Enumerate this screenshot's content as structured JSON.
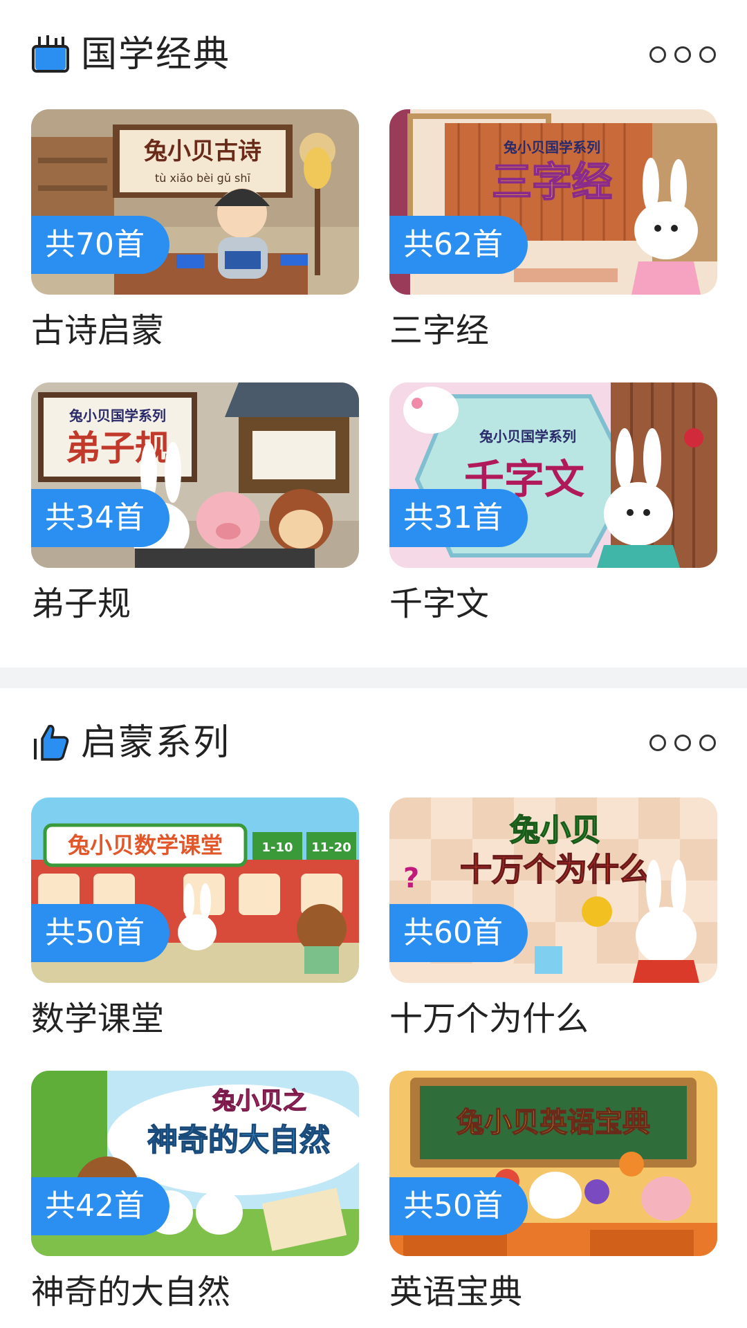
{
  "sections": [
    {
      "title": "国学经典",
      "icon": "pencil-cup-icon",
      "items": [
        {
          "count": "共70首",
          "title": "古诗启蒙",
          "art": {
            "brand": "兔小贝古诗",
            "pinyin": "tù xiǎo bèi gǔ shī"
          }
        },
        {
          "count": "共62首",
          "title": "三字经",
          "art": {
            "brand": "兔小贝国学系列",
            "name": "三字经"
          }
        },
        {
          "count": "共34首",
          "title": "弟子规",
          "art": {
            "brand": "兔小贝国学系列",
            "name": "弟子规"
          }
        },
        {
          "count": "共31首",
          "title": "千字文",
          "art": {
            "brand": "兔小贝国学系列",
            "name": "千字文"
          }
        }
      ]
    },
    {
      "title": "启蒙系列",
      "icon": "thumbs-up-icon",
      "items": [
        {
          "count": "共50首",
          "title": "数学课堂",
          "art": {
            "brand": "兔小贝数学课堂",
            "sign1": "1-10",
            "sign2": "11-20"
          }
        },
        {
          "count": "共60首",
          "title": "十万个为什么",
          "art": {
            "brand": "兔小贝",
            "name": "十万个为什么"
          }
        },
        {
          "count": "共42首",
          "title": "神奇的大自然",
          "art": {
            "brand": "兔小贝之",
            "name": "神奇的大自然"
          }
        },
        {
          "count": "共50首",
          "title": "英语宝典",
          "art": {
            "brand": "兔小贝英语宝典"
          }
        }
      ]
    }
  ],
  "colors": {
    "accent": "#2a8ff0",
    "divider": "#f2f3f5"
  }
}
